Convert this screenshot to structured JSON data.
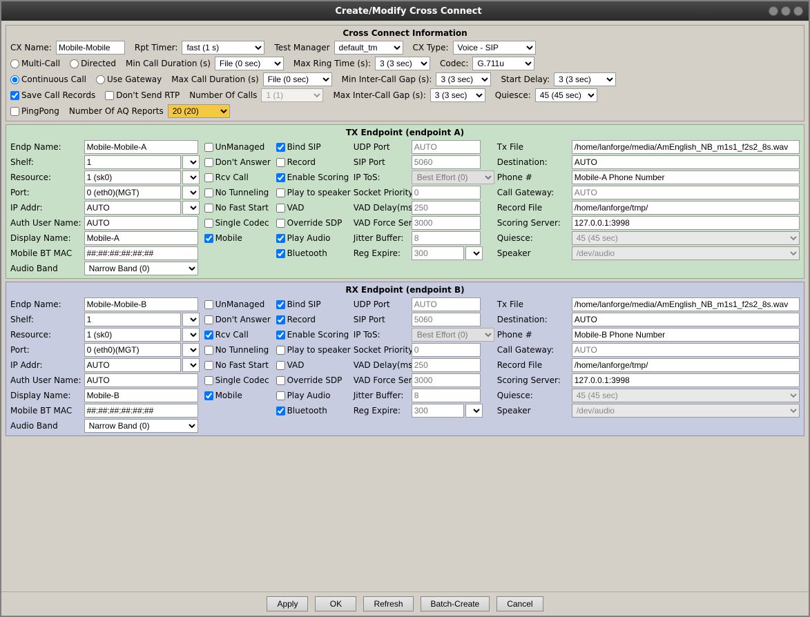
{
  "window": {
    "title": "Create/Modify Cross Connect",
    "controls": [
      "minimize",
      "maximize",
      "close"
    ]
  },
  "sections": {
    "cross_connect": {
      "title": "Cross Connect Information",
      "fields": {
        "cx_name_label": "CX Name:",
        "cx_name_value": "Mobile-Mobile",
        "rpt_timer_label": "Rpt Timer:",
        "rpt_timer_value": "fast    (1 s)",
        "test_manager_label": "Test Manager",
        "test_manager_value": "default_tm",
        "cx_type_label": "CX Type:",
        "cx_type_value": "Voice - SIP",
        "multi_call_label": "Multi-Call",
        "directed_label": "Directed",
        "min_call_duration_label": "Min Call Duration (s)",
        "min_call_duration_value": "File (0 sec)",
        "max_ring_time_label": "Max Ring Time (s):",
        "max_ring_time_value": "3 (3 sec)",
        "codec_label": "Codec:",
        "codec_value": "G.711u",
        "continuous_call_label": "Continuous Call",
        "use_gateway_label": "Use Gateway",
        "max_call_duration_label": "Max Call Duration (s)",
        "max_call_duration_value": "File (0 sec)",
        "min_intercall_gap_label": "Min Inter-Call Gap (s):",
        "min_intercall_gap_value": "3 (3 sec)",
        "start_delay_label": "Start Delay:",
        "start_delay_value": "3 (3 sec)",
        "save_call_records_label": "Save Call Records",
        "dont_send_rtp_label": "Don't Send RTP",
        "number_of_calls_label": "Number Of Calls",
        "number_of_calls_value": "1 (1)",
        "max_intercall_gap_label": "Max Inter-Call Gap (s):",
        "max_intercall_gap_value": "3 (3 sec)",
        "quiesce_label": "Quiesce:",
        "quiesce_value": "45 (45 sec)",
        "pingpong_label": "PingPong",
        "number_of_aq_reports_label": "Number Of AQ Reports",
        "number_of_aq_reports_value": "20 (20)"
      }
    },
    "tx_endpoint": {
      "title": "TX Endpoint (endpoint A)",
      "endp_name_label": "Endp Name:",
      "endp_name_value": "Mobile-Mobile-A",
      "unmanaged_label": "UnManaged",
      "bind_sip_label": "Bind SIP",
      "udp_port_label": "UDP Port",
      "udp_port_value": "AUTO",
      "tx_file_label": "Tx File",
      "tx_file_value": "/home/lanforge/media/AmEnglish_NB_m1s1_f2s2_8s.wav",
      "shelf_label": "Shelf:",
      "shelf_value": "1",
      "dont_answer_label": "Don't Answer",
      "record_label": "Record",
      "sip_port_label": "SIP Port",
      "sip_port_value": "5060",
      "destination_label": "Destination:",
      "destination_value": "AUTO",
      "resource_label": "Resource:",
      "resource_value": "1 (sk0)",
      "rcv_call_label": "Rcv Call",
      "enable_scoring_label": "Enable Scoring",
      "ip_tos_label": "IP ToS:",
      "ip_tos_value": "Best Effort    (0)",
      "phone_label": "Phone #",
      "phone_value": "Mobile-A Phone Number",
      "port_label": "Port:",
      "port_value": "0 (eth0)(MGT)",
      "no_tunneling_label": "No Tunneling",
      "play_to_speaker_label": "Play to speaker",
      "socket_priority_label": "Socket Priority:",
      "socket_priority_value": "0",
      "call_gateway_label": "Call Gateway:",
      "call_gateway_value": "AUTO",
      "ip_addr_label": "IP Addr:",
      "ip_addr_value": "AUTO",
      "no_fast_start_label": "No Fast Start",
      "vad_label": "VAD",
      "vad_delay_label": "VAD Delay(ms)",
      "vad_delay_value": "250",
      "record_file_label": "Record File",
      "record_file_value": "/home/lanforge/tmp/",
      "auth_user_label": "Auth User Name:",
      "auth_user_value": "AUTO",
      "single_codec_label": "Single Codec",
      "override_sdp_label": "Override SDP",
      "vad_force_send_label": "VAD Force Send",
      "vad_force_send_value": "3000",
      "scoring_server_label": "Scoring Server:",
      "scoring_server_value": "127.0.0.1:3998",
      "display_name_label": "Display Name:",
      "display_name_value": "Mobile-A",
      "mobile_label": "Mobile",
      "play_audio_label": "Play Audio",
      "jitter_buffer_label": "Jitter Buffer:",
      "jitter_buffer_value": "8",
      "quiesce_label": "Quiesce:",
      "quiesce_value": "45 (45 sec)",
      "mobile_bt_mac_label": "Mobile BT MAC",
      "mobile_bt_mac_value": "##:##:##:##:##:##",
      "bluetooth_label": "Bluetooth",
      "reg_expire_label": "Reg Expire:",
      "reg_expire_value": "300",
      "speaker_label": "Speaker",
      "speaker_value": "/dev/audio",
      "audio_band_label": "Audio Band",
      "audio_band_value": "Narrow Band (0)"
    },
    "rx_endpoint": {
      "title": "RX Endpoint (endpoint B)",
      "endp_name_label": "Endp Name:",
      "endp_name_value": "Mobile-Mobile-B",
      "unmanaged_label": "UnManaged",
      "bind_sip_label": "Bind SIP",
      "udp_port_label": "UDP Port",
      "udp_port_value": "AUTO",
      "tx_file_label": "Tx File",
      "tx_file_value": "/home/lanforge/media/AmEnglish_NB_m1s1_f2s2_8s.wav",
      "shelf_label": "Shelf:",
      "shelf_value": "1",
      "dont_answer_label": "Don't Answer",
      "record_label": "Record",
      "sip_port_label": "SIP Port",
      "sip_port_value": "5060",
      "destination_label": "Destination:",
      "destination_value": "AUTO",
      "resource_label": "Resource:",
      "resource_value": "1 (sk0)",
      "rcv_call_label": "Rcv Call",
      "enable_scoring_label": "Enable Scoring",
      "ip_tos_label": "IP ToS:",
      "ip_tos_value": "Best Effort    (0)",
      "phone_label": "Phone #",
      "phone_value": "Mobile-B Phone Number",
      "port_label": "Port:",
      "port_value": "0 (eth0)(MGT)",
      "no_tunneling_label": "No Tunneling",
      "play_to_speaker_label": "Play to speaker",
      "socket_priority_label": "Socket Priority:",
      "socket_priority_value": "0",
      "call_gateway_label": "Call Gateway:",
      "call_gateway_value": "AUTO",
      "ip_addr_label": "IP Addr:",
      "ip_addr_value": "AUTO",
      "no_fast_start_label": "No Fast Start",
      "vad_label": "VAD",
      "vad_delay_label": "VAD Delay(ms)",
      "vad_delay_value": "250",
      "record_file_label": "Record File",
      "record_file_value": "/home/lanforge/tmp/",
      "auth_user_label": "Auth User Name:",
      "auth_user_value": "AUTO",
      "single_codec_label": "Single Codec",
      "override_sdp_label": "Override SDP",
      "vad_force_send_label": "VAD Force Send",
      "vad_force_send_value": "3000",
      "scoring_server_label": "Scoring Server:",
      "scoring_server_value": "127.0.0.1:3998",
      "display_name_label": "Display Name:",
      "display_name_value": "Mobile-B",
      "mobile_label": "Mobile",
      "play_audio_label": "Play Audio",
      "jitter_buffer_label": "Jitter Buffer:",
      "jitter_buffer_value": "8",
      "quiesce_label": "Quiesce:",
      "quiesce_value": "45 (45 sec)",
      "mobile_bt_mac_label": "Mobile BT MAC",
      "mobile_bt_mac_value": "##:##:##:##:##:##",
      "bluetooth_label": "Bluetooth",
      "reg_expire_label": "Reg Expire:",
      "reg_expire_value": "300",
      "speaker_label": "Speaker",
      "speaker_value": "/dev/audio",
      "audio_band_label": "Audio Band",
      "audio_band_value": "Narrow Band (0)"
    }
  },
  "footer": {
    "apply_label": "Apply",
    "ok_label": "OK",
    "refresh_label": "Refresh",
    "batch_create_label": "Batch-Create",
    "cancel_label": "Cancel"
  }
}
